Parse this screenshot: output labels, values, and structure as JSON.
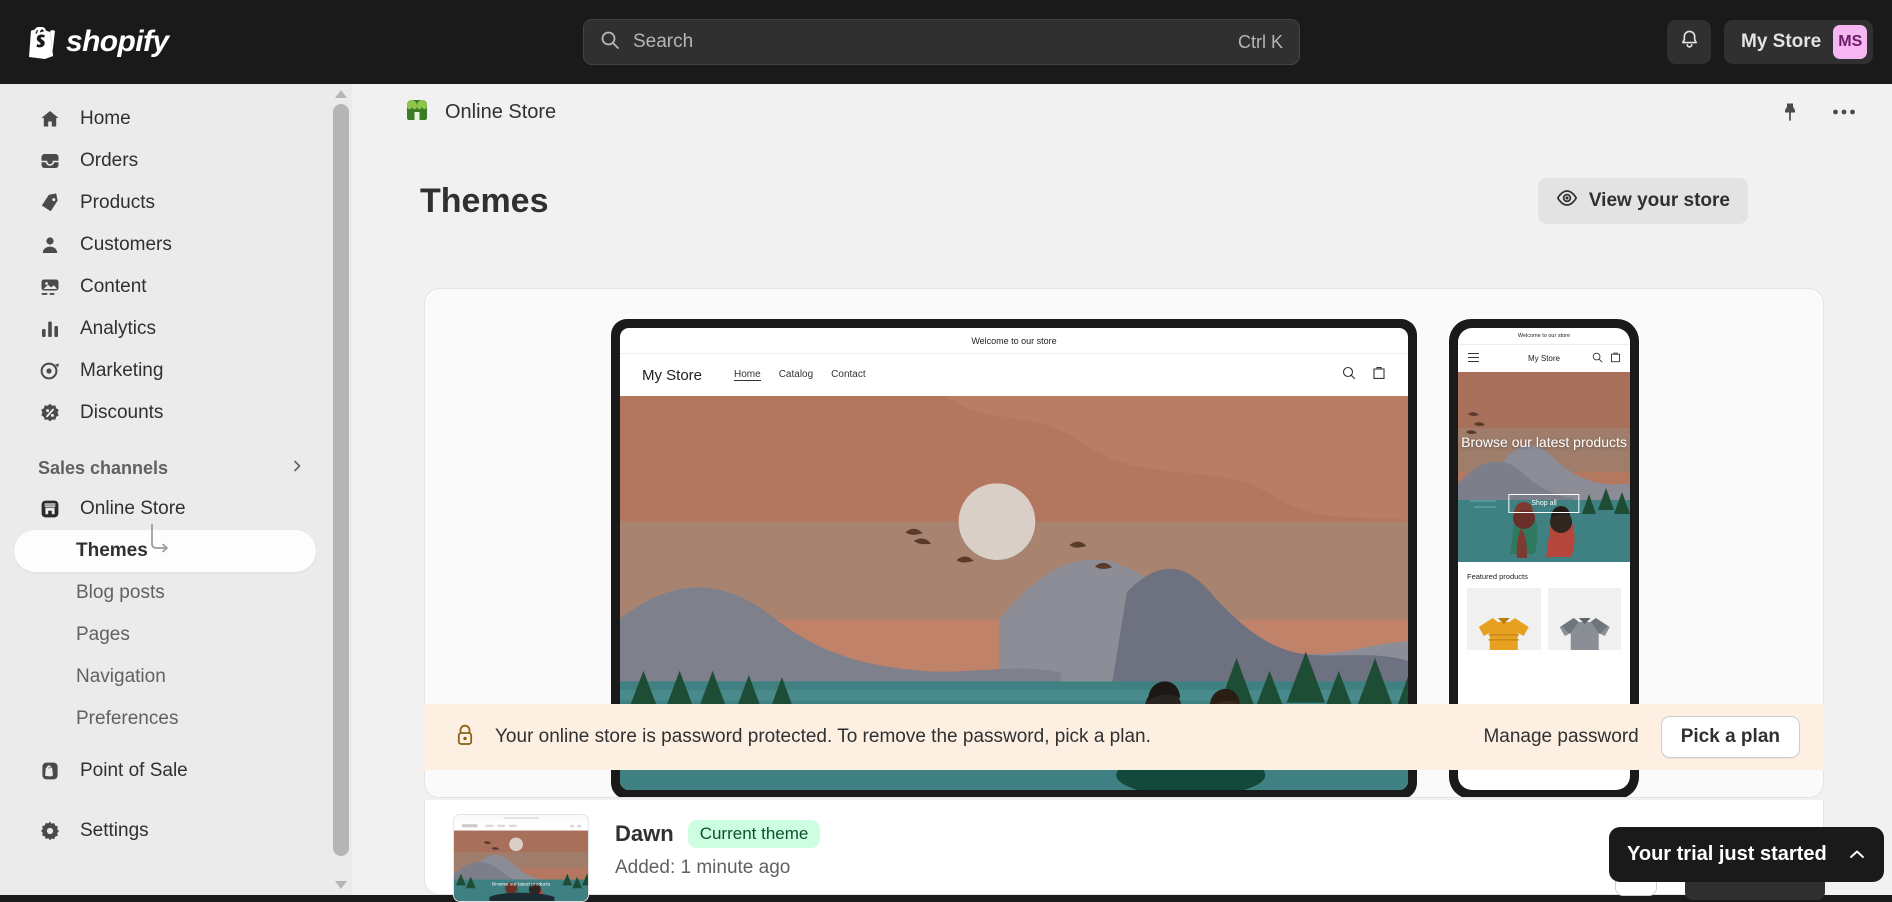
{
  "topbar": {
    "brand": "shopify",
    "brand_icon": "shopify-bag-icon",
    "search": {
      "placeholder": "Search",
      "shortcut": "Ctrl K",
      "icon": "search-icon"
    },
    "notifications_icon": "bell-icon",
    "store_name": "My Store",
    "avatar_initials": "MS",
    "avatar_bg": "#f6b6f2"
  },
  "sidebar": {
    "items": [
      {
        "label": "Home",
        "icon": "home-icon"
      },
      {
        "label": "Orders",
        "icon": "orders-inbox-icon"
      },
      {
        "label": "Products",
        "icon": "product-tag-icon"
      },
      {
        "label": "Customers",
        "icon": "person-icon"
      },
      {
        "label": "Content",
        "icon": "content-image-icon"
      },
      {
        "label": "Analytics",
        "icon": "bar-chart-icon"
      },
      {
        "label": "Marketing",
        "icon": "megaphone-target-icon"
      },
      {
        "label": "Discounts",
        "icon": "discount-percent-icon"
      }
    ],
    "section": {
      "label": "Sales channels",
      "chevron_icon": "chevron-right-icon"
    },
    "channel": {
      "label": "Online Store",
      "icon": "storefront-icon"
    },
    "sub_items": [
      {
        "label": "Themes",
        "active": true
      },
      {
        "label": "Blog posts",
        "active": false
      },
      {
        "label": "Pages",
        "active": false
      },
      {
        "label": "Navigation",
        "active": false
      },
      {
        "label": "Preferences",
        "active": false
      }
    ],
    "pos": {
      "label": "Point of Sale",
      "icon": "shopify-pos-icon"
    },
    "settings": {
      "label": "Settings",
      "icon": "gear-icon"
    }
  },
  "context_bar": {
    "title": "Online Store",
    "icon": "online-store-green-icon",
    "pin_icon": "pin-icon",
    "more_icon": "more-horizontal-icon"
  },
  "page": {
    "title": "Themes",
    "view_store_label": "View your store",
    "view_store_icon": "eye-icon"
  },
  "preview": {
    "desktop": {
      "announcement": "Welcome to our store",
      "brand": "My Store",
      "nav_links": [
        "Home",
        "Catalog",
        "Contact"
      ],
      "active_link": "Home",
      "search_icon": "search-icon",
      "cart_icon": "shopping-bag-icon"
    },
    "mobile": {
      "announcement": "Welcome to our store",
      "menu_icon": "hamburger-menu-icon",
      "brand": "My Store",
      "search_icon": "search-icon",
      "cart_icon": "shopping-bag-icon",
      "hero_heading": "Browse our latest products",
      "hero_cta": "Shop all",
      "featured_title": "Featured products"
    }
  },
  "password_banner": {
    "icon": "lock-icon",
    "message": "Your online store is password protected. To remove the password, pick a plan.",
    "manage_label": "Manage password",
    "pick_plan_label": "Pick a plan",
    "background": "#fdf0e3"
  },
  "theme_row": {
    "name": "Dawn",
    "badge": "Current theme",
    "badge_bg": "#cdfee1",
    "added": "Added: 1 minute ago",
    "thumb_caption": "Browse our latest products"
  },
  "toast": {
    "message": "Your trial just started",
    "chevron_icon": "chevron-up-icon"
  }
}
